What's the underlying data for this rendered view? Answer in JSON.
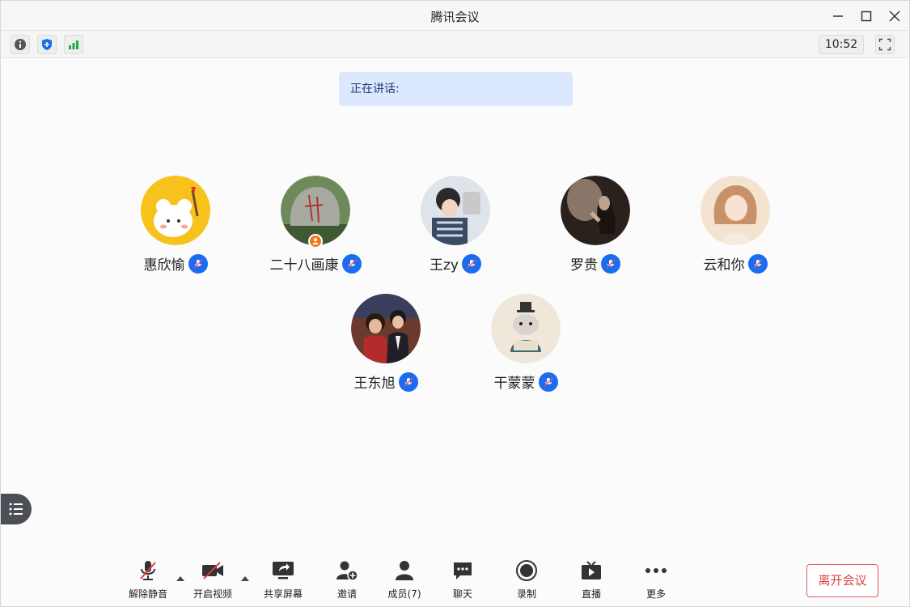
{
  "window": {
    "title": "腾讯会议"
  },
  "strip": {
    "time": "10:52"
  },
  "speaking": {
    "label": "正在讲话:"
  },
  "participants": [
    {
      "name": "惠欣愉"
    },
    {
      "name": "二十八画康"
    },
    {
      "name": "王zy"
    },
    {
      "name": "罗贵"
    },
    {
      "name": "云和你"
    },
    {
      "name": "王东旭"
    },
    {
      "name": "干蒙蒙"
    }
  ],
  "toolbar": {
    "unmute": "解除静音",
    "start_video": "开启视频",
    "share_screen": "共享屏幕",
    "invite": "邀请",
    "members": "成员(7)",
    "chat": "聊天",
    "record": "录制",
    "live": "直播",
    "more": "更多",
    "leave": "离开会议"
  },
  "colors": {
    "accent": "#1a6cf1",
    "leave": "#e0413f",
    "speaking_bg": "#dbe8fd",
    "host_badge": "#f27a1a"
  }
}
